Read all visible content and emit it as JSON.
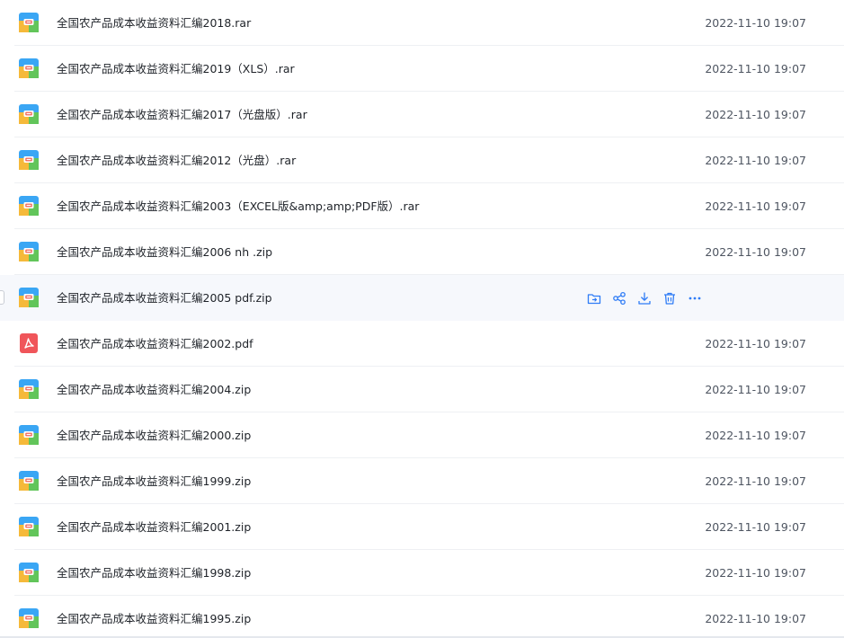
{
  "files": [
    {
      "name": "全国农产品成本收益资料汇编2018.rar",
      "date": "2022-11-10 19:07",
      "icon": "archive-icon"
    },
    {
      "name": "全国农产品成本收益资料汇编2019（XLS）.rar",
      "date": "2022-11-10 19:07",
      "icon": "archive-icon"
    },
    {
      "name": "全国农产品成本收益资料汇编2017（光盘版）.rar",
      "date": "2022-11-10 19:07",
      "icon": "archive-icon"
    },
    {
      "name": "全国农产品成本收益资料汇编2012（光盘）.rar",
      "date": "2022-11-10 19:07",
      "icon": "archive-icon"
    },
    {
      "name": "全国农产品成本收益资料汇编2003（EXCEL版&amp;amp;PDF版）.rar",
      "date": "2022-11-10 19:07",
      "icon": "archive-icon"
    },
    {
      "name": "全国农产品成本收益资料汇编2006 nh .zip",
      "date": "2022-11-10 19:07",
      "icon": "archive-icon"
    },
    {
      "name": "全国农产品成本收益资料汇编2005 pdf.zip",
      "date": "",
      "icon": "archive-icon",
      "hovered": true
    },
    {
      "name": "全国农产品成本收益资料汇编2002.pdf",
      "date": "2022-11-10 19:07",
      "icon": "pdf-icon"
    },
    {
      "name": "全国农产品成本收益资料汇编2004.zip",
      "date": "2022-11-10 19:07",
      "icon": "archive-icon"
    },
    {
      "name": "全国农产品成本收益资料汇编2000.zip",
      "date": "2022-11-10 19:07",
      "icon": "archive-icon"
    },
    {
      "name": "全国农产品成本收益资料汇编1999.zip",
      "date": "2022-11-10 19:07",
      "icon": "archive-icon"
    },
    {
      "name": "全国农产品成本收益资料汇编2001.zip",
      "date": "2022-11-10 19:07",
      "icon": "archive-icon"
    },
    {
      "name": "全国农产品成本收益资料汇编1998.zip",
      "date": "2022-11-10 19:07",
      "icon": "archive-icon"
    },
    {
      "name": "全国农产品成本收益资料汇编1995.zip",
      "date": "2022-11-10 19:07",
      "icon": "archive-icon"
    }
  ],
  "hover_actions": [
    {
      "name": "move-to-folder-icon"
    },
    {
      "name": "share-icon"
    },
    {
      "name": "download-icon"
    },
    {
      "name": "delete-icon"
    },
    {
      "name": "more-icon"
    }
  ],
  "colors": {
    "accent": "#2f7cf6",
    "archive_top": "#3aa6f4",
    "archive_left": "#f5b93a",
    "archive_right": "#62c55a",
    "archive_clasp": "#ef5a4c",
    "pdf": "#f0555a"
  }
}
